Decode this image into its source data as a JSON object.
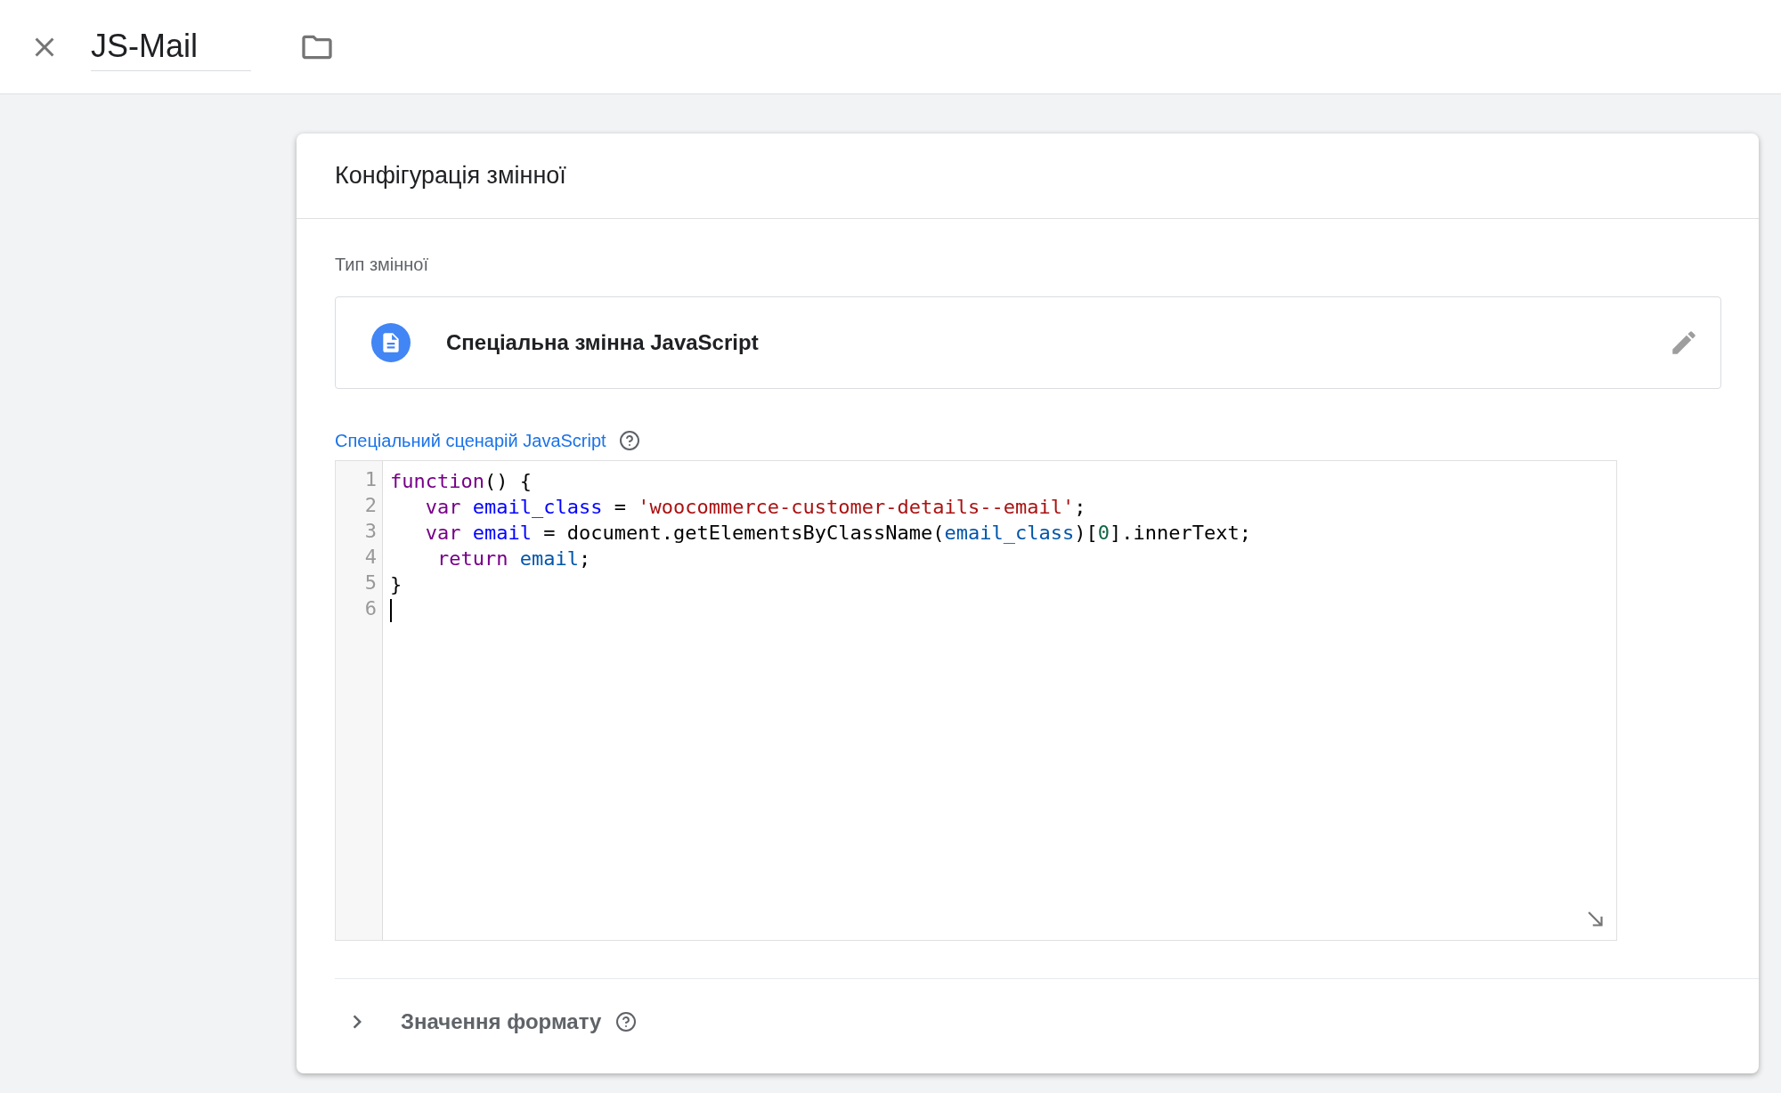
{
  "header": {
    "name_value": "JS-Mail"
  },
  "card": {
    "title": "Конфігурація змінної",
    "type_section": {
      "label": "Тип змінної",
      "type_name": "Спеціальна змінна JavaScript"
    },
    "code_section": {
      "label": "Спеціальний сценарій JavaScript",
      "lines": [
        {
          "number": "1",
          "has_cursor": false,
          "tokens": [
            {
              "kind": "keyword",
              "text": "function"
            },
            {
              "kind": "plain",
              "text": "() {"
            }
          ]
        },
        {
          "number": "2",
          "has_cursor": false,
          "tokens": [
            {
              "kind": "keyword",
              "text": "   var "
            },
            {
              "kind": "def",
              "text": "email_class"
            },
            {
              "kind": "plain",
              "text": " = "
            },
            {
              "kind": "string",
              "text": "'woocommerce-customer-details--email'"
            },
            {
              "kind": "plain",
              "text": ";"
            }
          ]
        },
        {
          "number": "3",
          "has_cursor": false,
          "tokens": [
            {
              "kind": "keyword",
              "text": "   var "
            },
            {
              "kind": "def",
              "text": "email"
            },
            {
              "kind": "plain",
              "text": " = document.getElementsByClassName("
            },
            {
              "kind": "variable",
              "text": "email_class"
            },
            {
              "kind": "plain",
              "text": ")["
            },
            {
              "kind": "number",
              "text": "0"
            },
            {
              "kind": "plain",
              "text": "].innerText;"
            }
          ]
        },
        {
          "number": "4",
          "has_cursor": false,
          "tokens": [
            {
              "kind": "keyword",
              "text": "    return "
            },
            {
              "kind": "variable",
              "text": "email"
            },
            {
              "kind": "plain",
              "text": ";"
            }
          ]
        },
        {
          "number": "5",
          "has_cursor": false,
          "tokens": [
            {
              "kind": "plain",
              "text": "}"
            }
          ]
        },
        {
          "number": "6",
          "has_cursor": true
        }
      ]
    },
    "format_section": {
      "label": "Значення формату",
      "expanded": false
    }
  }
}
